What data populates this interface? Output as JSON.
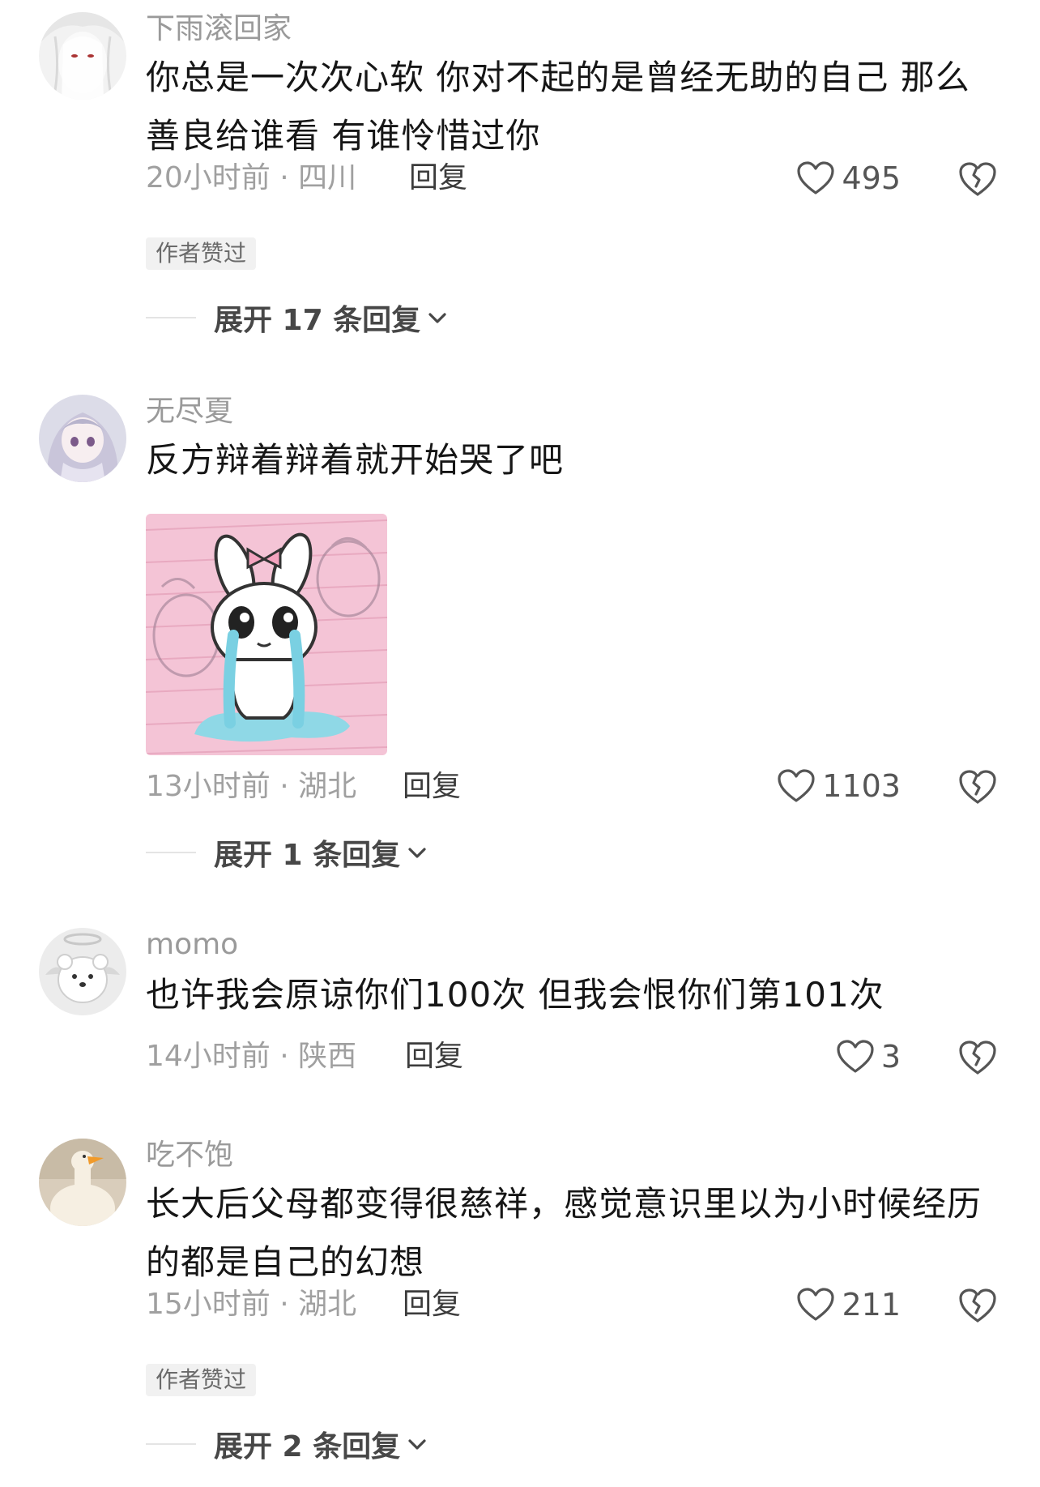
{
  "comments": [
    {
      "username": "下雨滚回家",
      "text": "你总是一次次心软 你对不起的是曾经无助的自己 那么善良给谁看 有谁怜惜过你",
      "time": "20小时前",
      "location": "四川",
      "reply_label": "回复",
      "likes": "495",
      "badge": "作者赞过",
      "expand_label": "展开 17 条回复"
    },
    {
      "username": "无尽夏",
      "text": "反方辩着辩着就开始哭了吧",
      "time": "13小时前",
      "location": "湖北",
      "reply_label": "回复",
      "likes": "1103",
      "expand_label": "展开 1 条回复"
    },
    {
      "username": "momo",
      "text": "也许我会原谅你们100次 但我会恨你们第101次",
      "time": "14小时前",
      "location": "陕西",
      "reply_label": "回复",
      "likes": "3"
    },
    {
      "username": "吃不饱",
      "text": "长大后父母都变得很慈祥，感觉意识里以为小时候经历的都是自己的幻想",
      "time": "15小时前",
      "location": "湖北",
      "reply_label": "回复",
      "likes": "211",
      "badge": "作者赞过",
      "expand_label": "展开 2 条回复"
    }
  ],
  "meta_separator": " · ",
  "icons": {
    "like": "heart-outline-icon",
    "dislike": "broken-heart-icon",
    "expand": "chevron-down-icon"
  },
  "colors": {
    "meta_gray": "#a0a0a0",
    "text": "#161616",
    "sticker_bg": "#f4c4d6",
    "tear_blue": "#8fd8e6"
  }
}
